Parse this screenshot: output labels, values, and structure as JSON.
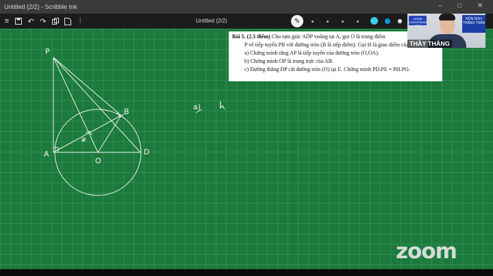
{
  "window": {
    "title": "Untitled (2/2) - Scribble Ink",
    "controls": [
      "–",
      "□",
      "✕"
    ]
  },
  "toolbar": {
    "doc_title": "Untitled (2/2)",
    "icons": [
      "menu-icon",
      "save-icon",
      "undo-icon",
      "redo-icon",
      "copy-icon",
      "page-icon",
      "settings-icon"
    ],
    "pen_icon": "pen-icon",
    "colors": [
      "#3ad1e6",
      "#0a9ad6",
      "#ffffff"
    ]
  },
  "problem": {
    "heading": "Bài 5. (2.5 điểm)",
    "line1": "Cho tam giác ADP vuông tại A, gọi O là trung điểm",
    "line2": "P vẽ tiếp tuyến PB với đường tròn (B là tiếp điểm). Gọi H là giao điểm của AB và OP.",
    "part_a": "a)  Chứng minh rằng AP là tiếp tuyến của đường tròn (O,OA).",
    "part_b": "b)  Chứng minh OP là trung trực của AB.",
    "part_c": "c)  Đường thẳng DP cắt đường tròn (O) tại E. Chứng minh PD.PE = PH.PO."
  },
  "drawing": {
    "points": {
      "P": "P",
      "A": "A",
      "B": "B",
      "O": "O",
      "D": "D"
    },
    "annotation": "a)"
  },
  "webcam": {
    "name": "THẦY THẮNG",
    "card_text": "NHÓM LIVESTREAM HỌC",
    "banner": "RÔN DỌH THẮNG THÂN"
  },
  "zoom": {
    "logo": "zoom"
  }
}
